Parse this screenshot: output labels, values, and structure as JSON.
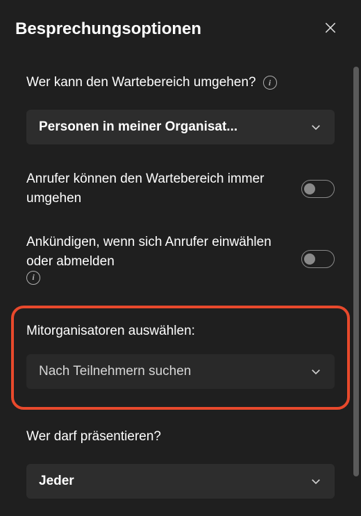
{
  "header": {
    "title": "Besprechungsoptionen"
  },
  "lobby": {
    "label": "Wer kann den Wartebereich umgehen?",
    "selected": "Personen in meiner Organisat..."
  },
  "callersBypass": {
    "label": "Anrufer können den Wartebereich immer umgehen",
    "on": false
  },
  "announce": {
    "label": "Ankündigen, wenn sich Anrufer einwählen oder abmelden",
    "on": false
  },
  "coorganizers": {
    "label": "Mitorganisatoren auswählen:",
    "placeholder": "Nach Teilnehmern suchen"
  },
  "presenters": {
    "label": "Wer darf präsentieren?",
    "selected": "Jeder"
  }
}
